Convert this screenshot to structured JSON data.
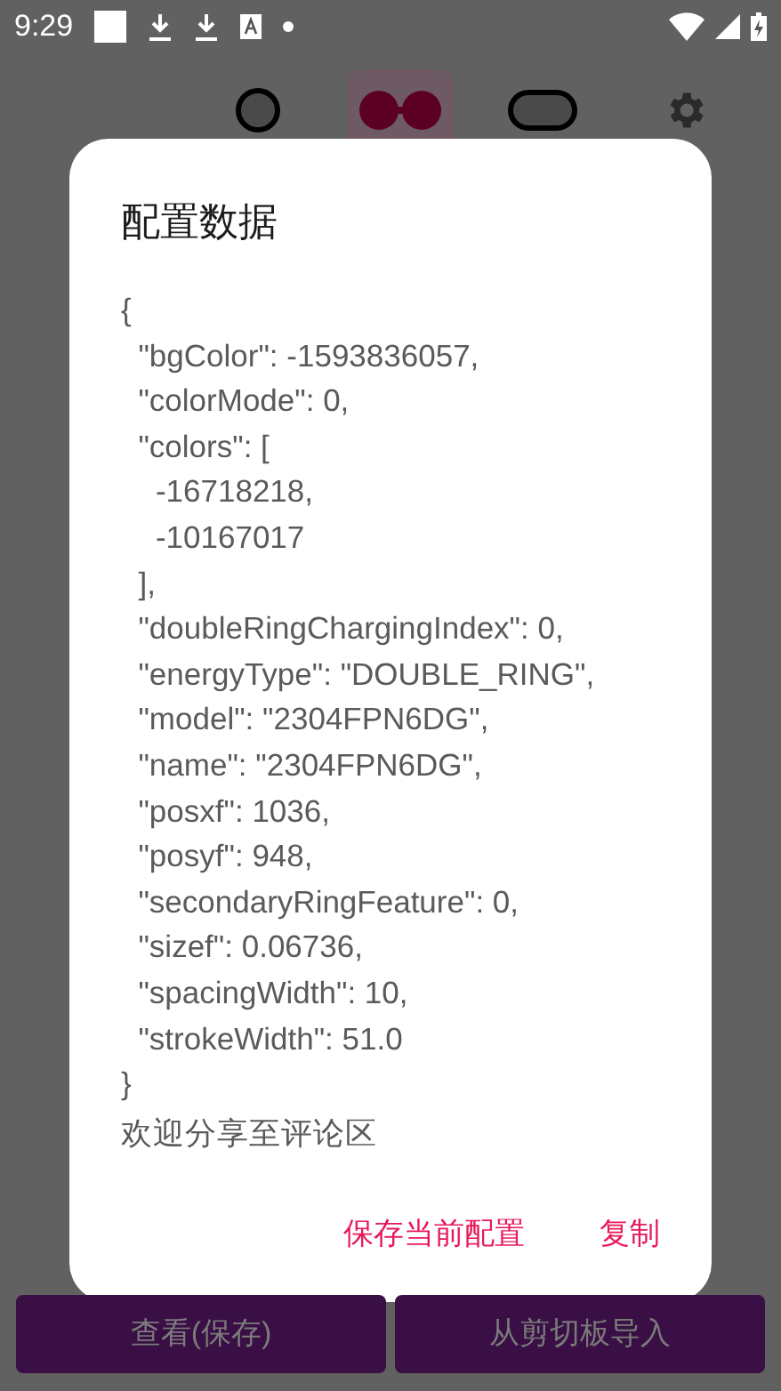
{
  "status_bar": {
    "time": "9:29"
  },
  "toolbar": {
    "items": [
      {
        "kind": "ring",
        "selected": false
      },
      {
        "kind": "double",
        "selected": true
      },
      {
        "kind": "pill",
        "selected": false
      },
      {
        "kind": "settings",
        "selected": false
      }
    ]
  },
  "dialog": {
    "title": "配置数据",
    "content": "{\n  \"bgColor\": -1593836057,\n  \"colorMode\": 0,\n  \"colors\": [\n    -16718218,\n    -10167017\n  ],\n  \"doubleRingChargingIndex\": 0,\n  \"energyType\": \"DOUBLE_RING\",\n  \"model\": \"2304FPN6DG\",\n  \"name\": \"2304FPN6DG\",\n  \"posxf\": 1036,\n  \"posyf\": 948,\n  \"secondaryRingFeature\": 0,\n  \"sizef\": 0.06736,\n  \"spacingWidth\": 10,\n  \"strokeWidth\": 51.0\n}",
    "note": "欢迎分享至评论区",
    "actions": [
      "保存当前配置",
      "复制"
    ]
  },
  "bottom_buttons": [
    "查看(保存)",
    "从剪切板导入"
  ]
}
